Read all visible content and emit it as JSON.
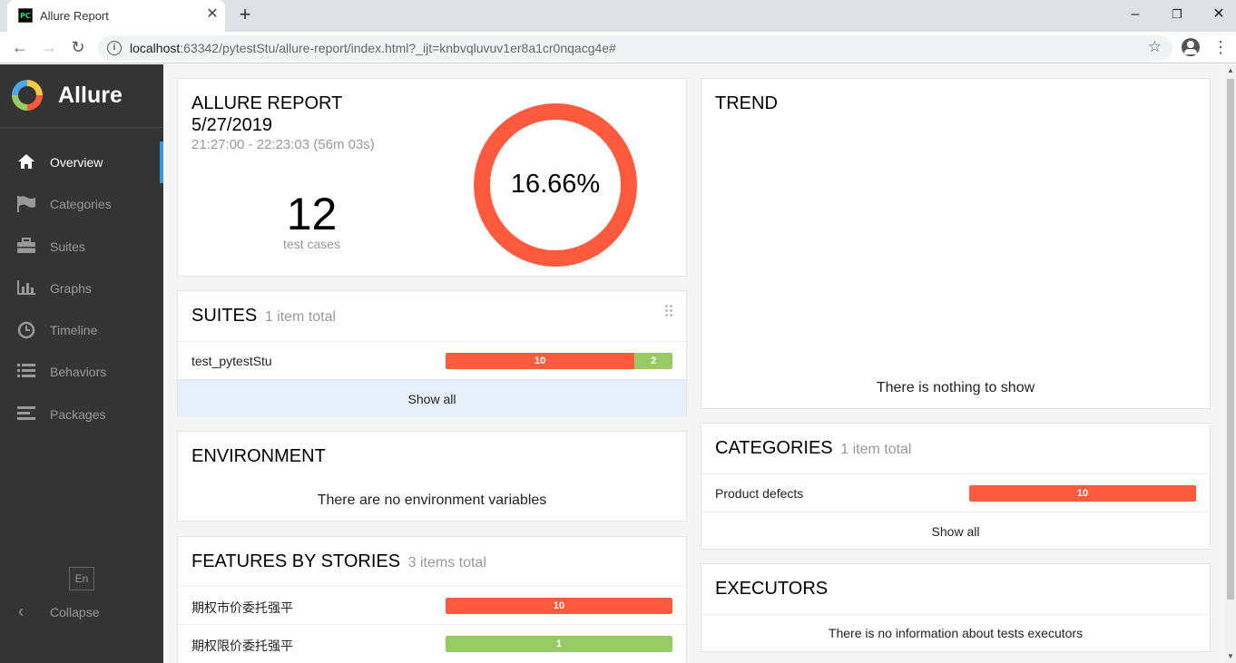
{
  "browser": {
    "tab_title": "Allure Report",
    "favicon_text": "PC",
    "url_host": "localhost",
    "url_rest": ":63342/pytestStu/allure-report/index.html?_ijt=knbvqluvuv1er8a1cr0nqacg4e#"
  },
  "sidebar": {
    "brand": "Allure",
    "items": [
      {
        "label": "Overview",
        "icon": "home-icon",
        "active": true
      },
      {
        "label": "Categories",
        "icon": "flag-icon"
      },
      {
        "label": "Suites",
        "icon": "briefcase-icon"
      },
      {
        "label": "Graphs",
        "icon": "bar-chart-icon"
      },
      {
        "label": "Timeline",
        "icon": "clock-icon"
      },
      {
        "label": "Behaviors",
        "icon": "list-icon"
      },
      {
        "label": "Packages",
        "icon": "align-left-icon"
      }
    ],
    "language": "En",
    "collapse_label": "Collapse"
  },
  "summary": {
    "title": "ALLURE REPORT",
    "date": "5/27/2019",
    "time_range": "21:27:00 - 22:23:03 (56m 03s)",
    "test_count": "12",
    "test_count_label": "test cases",
    "success_rate": "16.66%",
    "passed_fraction": 0.1666
  },
  "suites": {
    "title": "SUITES",
    "subtitle": "1 item total",
    "rows": [
      {
        "name": "test_pytestStu",
        "failed": 10,
        "passed": 2
      }
    ],
    "show_all": "Show all"
  },
  "environment": {
    "title": "ENVIRONMENT",
    "message": "There are no environment variables"
  },
  "features": {
    "title": "FEATURES BY STORIES",
    "subtitle": "3 items total",
    "rows": [
      {
        "name": "期权市价委托强平",
        "failed": 10,
        "passed": 0
      },
      {
        "name": "期权限价委托强平",
        "failed": 0,
        "passed": 1
      }
    ]
  },
  "trend": {
    "title": "TREND",
    "message": "There is nothing to show"
  },
  "categories": {
    "title": "CATEGORIES",
    "subtitle": "1 item total",
    "rows": [
      {
        "name": "Product defects",
        "failed": 10
      }
    ],
    "show_all": "Show all"
  },
  "executors": {
    "title": "EXECUTORS",
    "message": "There is no information about tests executors"
  },
  "colors": {
    "failed": "#fd5a3e",
    "passed": "#97cc64",
    "sidebar_bg": "#343434",
    "active_accent": "#3498db"
  }
}
